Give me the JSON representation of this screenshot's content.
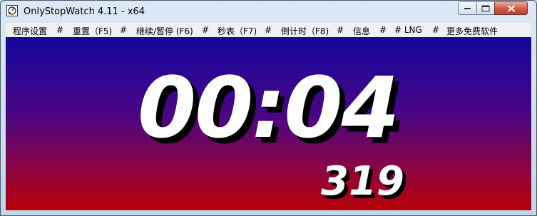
{
  "window": {
    "title": "OnlyStopWatch 4.11 - x64",
    "app_icon": "stopwatch-app-icon",
    "buttons": {
      "minimize": "minimize-icon",
      "maximize": "maximize-icon",
      "close": "close-icon"
    }
  },
  "menu": {
    "items": [
      {
        "label": "程序设置"
      },
      {
        "label": "#"
      },
      {
        "label": "重置（F5)"
      },
      {
        "label": "#"
      },
      {
        "label": "继续/暂停 (F6)"
      },
      {
        "label": "#"
      },
      {
        "label": "秒表（F7)"
      },
      {
        "label": "#"
      },
      {
        "label": "倒计时（F8)"
      },
      {
        "label": "#"
      },
      {
        "label": "信息"
      },
      {
        "label": "#"
      },
      {
        "label": "# LNG"
      },
      {
        "label": "#"
      },
      {
        "label": "更多免费软件"
      }
    ]
  },
  "display": {
    "time": "00:04",
    "milliseconds": "319"
  },
  "colors": {
    "background_top": "#14079c",
    "background_bottom": "#b50206",
    "digits": "#ffffff",
    "digit_shadow": "#000000"
  }
}
